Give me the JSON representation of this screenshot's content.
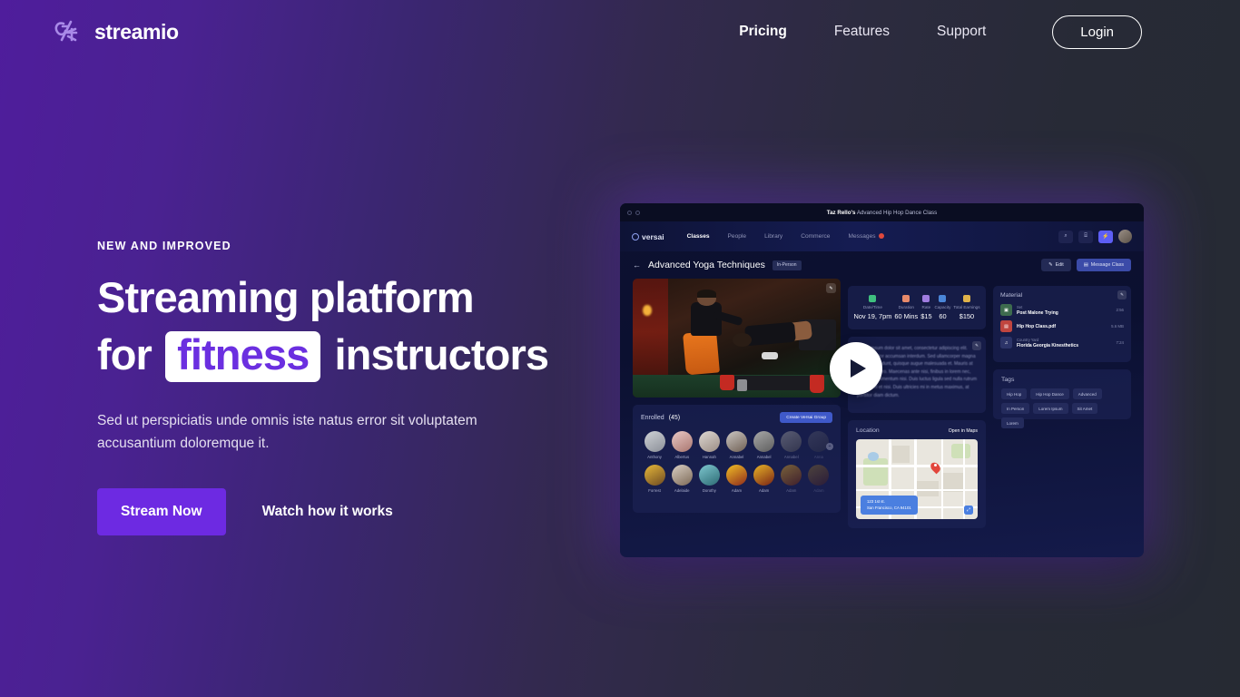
{
  "header": {
    "brand": "streamio",
    "logo_icon": "abstract-mark-icon",
    "nav": [
      {
        "label": "Pricing",
        "active": true
      },
      {
        "label": "Features",
        "active": false
      },
      {
        "label": "Support",
        "active": false
      }
    ],
    "login_label": "Login"
  },
  "hero": {
    "eyebrow": "NEW AND IMPROVED",
    "headline_line1": "Streaming platform",
    "headline_line2_pre": "for",
    "headline_highlight": "fitness",
    "headline_line2_post": "instructors",
    "subtitle": "Sed ut perspiciatis unde omnis iste natus error sit voluptatem accusantium doloremque it.",
    "primary_cta": "Stream Now",
    "secondary_cta": "Watch how it works",
    "accent_color": "#6d2ae2",
    "highlight_text_color": "#6b2fe0"
  },
  "app": {
    "titlebar": {
      "owner": "Taz Rello's",
      "class_name": "Advanced Hip Hop Dance Class"
    },
    "nav": {
      "brand": "versai",
      "items": [
        {
          "label": "Classes",
          "active": true
        },
        {
          "label": "People",
          "active": false
        },
        {
          "label": "Library",
          "active": false
        },
        {
          "label": "Commerce",
          "active": false
        },
        {
          "label": "Messages",
          "active": false,
          "badge": true
        }
      ],
      "icons": [
        "search-icon",
        "presentation-icon",
        "bolt-icon",
        "avatar"
      ]
    },
    "page": {
      "back_icon": "back-arrow-icon",
      "title": "Advanced Yoga Techniques",
      "badge": "In-Person",
      "edit_label": "Edit",
      "message_label": "Message Class"
    },
    "stats": [
      {
        "label": "Date/Time",
        "value": "Nov 19, 7pm",
        "color": "#3fbf7f"
      },
      {
        "label": "Duration",
        "value": "60 Mins",
        "color": "#e88a6a"
      },
      {
        "label": "Rate",
        "value": "$15",
        "color": "#a07de0"
      },
      {
        "label": "Capacity",
        "value": "60",
        "color": "#4a86d8"
      },
      {
        "label": "Total Earnings",
        "value": "$150",
        "color": "#e0b24a"
      }
    ],
    "description": "Lorem ipsum dolor sit amet, consectetur adipiscing elit. Nulla porttitor accumsan interdum. Sed ullamcorper magna quis leo tincidunt, quisque augue malesuada et. Mauris at tincidunt libero. Maecenas ante nisi, finibus in lorem nec, lacinia condimentum nisi. Duis luctus ligula sed nulla rutrum dictum vel et nisi. Duis ultricies mi in metus maximus, at porttitor diam dictum.",
    "material": {
      "title": "Material",
      "items": [
        {
          "sub": "Set",
          "name": "Post Malone Trying",
          "size": "2:56",
          "kind": "audio",
          "color": "#3d6b4e"
        },
        {
          "sub": "",
          "name": "Hip Hop Class.pdf",
          "size": "5.6 MB",
          "kind": "pdf",
          "color": "#c0453f"
        },
        {
          "sub": "Country Yard",
          "name": "Florida Georgia Kinesthetics",
          "size": "7:24",
          "kind": "music",
          "color": "#2c3468"
        }
      ]
    },
    "enrolled": {
      "title": "Enrolled",
      "count": "(45)",
      "button": "Create Versai Group",
      "more_badge": "+",
      "people": [
        {
          "name": "Anthony",
          "c1": "#cfd2d6",
          "c2": "#8b8f98"
        },
        {
          "name": "Albertus",
          "c1": "#e9c9c6",
          "c2": "#a9766f"
        },
        {
          "name": "Hannah",
          "c1": "#ded8d3",
          "c2": "#9b8d84"
        },
        {
          "name": "Annabel",
          "c1": "#cbc7c3",
          "c2": "#6f5f53"
        },
        {
          "name": "Annabel",
          "c1": "#a8a8a8",
          "c2": "#5e5e5e"
        },
        {
          "name": "Annabel",
          "c1": "#8f8f95",
          "c2": "#4a4a52"
        },
        {
          "name": "Anna",
          "c1": "#6f7079",
          "c2": "#3a3a42"
        },
        {
          "name": "Forrest",
          "c1": "#e7b83a",
          "c2": "#6d4a22"
        },
        {
          "name": "Adelaide",
          "c1": "#d9cfc4",
          "c2": "#7d6a57"
        },
        {
          "name": "Dorothy",
          "c1": "#7ec7cf",
          "c2": "#2d6b74"
        },
        {
          "name": "Adam",
          "c1": "#f2c026",
          "c2": "#8e2a1c"
        },
        {
          "name": "Adam",
          "c1": "#e8b427",
          "c2": "#7a2416"
        },
        {
          "name": "Adam",
          "c1": "#d9a62a",
          "c2": "#66200f"
        },
        {
          "name": "Adam",
          "c1": "#c9991f",
          "c2": "#55190c"
        }
      ]
    },
    "location": {
      "title": "Location",
      "link": "Open in Maps",
      "address_line1": "123 1st st.",
      "address_line2": "San Francisco, CA 94101"
    },
    "tags": {
      "title": "Tags",
      "items": [
        "Hip Hop",
        "Hip Hop Dance",
        "Advanced",
        "In Person",
        "Lorem Ipsum",
        "Sit Amet",
        "Lorem"
      ]
    }
  }
}
